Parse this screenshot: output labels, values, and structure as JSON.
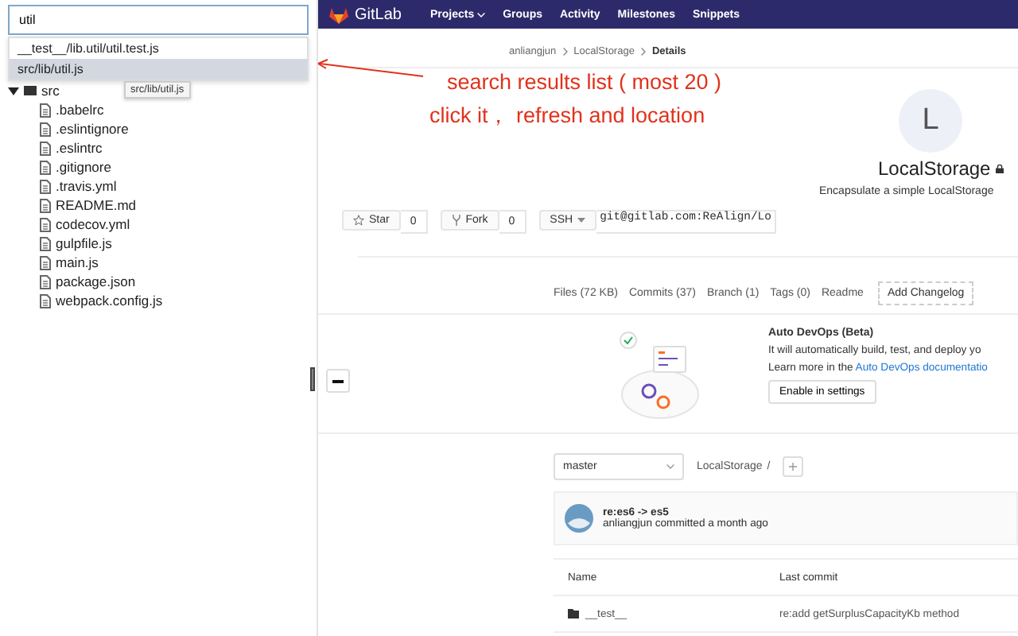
{
  "sidebar": {
    "search": {
      "value": "util"
    },
    "results": [
      {
        "label": "__test__/lib.util/util.test.js",
        "selected": false
      },
      {
        "label": "src/lib/util.js",
        "selected": true
      }
    ],
    "tooltip": "src/lib/util.js",
    "tree": [
      {
        "name": "src",
        "kind": "folder",
        "expanded": true
      },
      {
        "name": ".babelrc",
        "kind": "file"
      },
      {
        "name": ".eslintignore",
        "kind": "file"
      },
      {
        "name": ".eslintrc",
        "kind": "file"
      },
      {
        "name": ".gitignore",
        "kind": "file"
      },
      {
        "name": ".travis.yml",
        "kind": "file"
      },
      {
        "name": "README.md",
        "kind": "file"
      },
      {
        "name": "codecov.yml",
        "kind": "file"
      },
      {
        "name": "gulpfile.js",
        "kind": "file"
      },
      {
        "name": "main.js",
        "kind": "file"
      },
      {
        "name": "package.json",
        "kind": "file"
      },
      {
        "name": "webpack.config.js",
        "kind": "file"
      }
    ]
  },
  "annotation": {
    "lines": [
      "search results list ( most 20 )",
      "click it， refresh and location"
    ]
  },
  "gitlab": {
    "logo": "GitLab",
    "nav": [
      {
        "label": "Projects",
        "has_menu": true
      },
      {
        "label": "Groups",
        "has_menu": false
      },
      {
        "label": "Activity",
        "has_menu": false
      },
      {
        "label": "Milestones",
        "has_menu": false
      },
      {
        "label": "Snippets",
        "has_menu": false
      }
    ],
    "breadcrumb": [
      "anliangjun",
      "LocalStorage",
      "Details"
    ],
    "project": {
      "avatar_letter": "L",
      "name": "LocalStorage",
      "private": true,
      "description": "Encapsulate a simple LocalStorage"
    },
    "actions": [
      {
        "label": "Star",
        "count": "0",
        "kind": "star"
      },
      {
        "label": "Fork",
        "count": "0",
        "kind": "fork"
      }
    ],
    "clone": {
      "protocol": "SSH",
      "url": "git@gitlab.com:ReAlign/Lo"
    },
    "stats": [
      "Files (72 KB)",
      "Commits (37)",
      "Branch (1)",
      "Tags (0)",
      "Readme"
    ],
    "stats_button": "Add Changelog",
    "devops": {
      "title": "Auto DevOps (Beta)",
      "text": "It will automatically build, test, and deploy yo",
      "learn_prefix": "Learn more in the ",
      "learn_link": "Auto DevOps documentatio",
      "button": "Enable in settings"
    },
    "branch": "master",
    "path": "LocalStorage",
    "path_sep": "/",
    "commit": {
      "title": "re:es6 -> es5",
      "meta": "anliangjun committed a month ago"
    },
    "table": {
      "columns": [
        "Name",
        "Last commit"
      ],
      "rows": [
        {
          "name": "__test__",
          "last_commit": "re:add getSurplusCapacityKb method"
        }
      ]
    }
  }
}
